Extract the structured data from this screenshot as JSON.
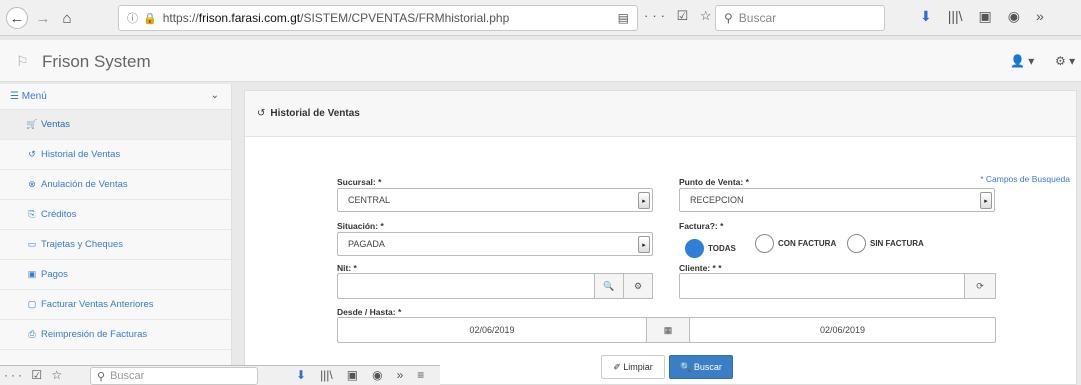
{
  "browser": {
    "url_host": "frison.farasi.com.gt",
    "url_prefix": "https://",
    "url_path": "/SISTEM/CPVENTAS/FRMhistorial.php",
    "search_placeholder": "Buscar",
    "back_glyph": "←",
    "forward_glyph": "→",
    "home_glyph": "⌂",
    "info_glyph": "ⓘ",
    "lock_glyph": "🔒",
    "reader_glyph": "▤",
    "page_actions": "··· ☑ ☆",
    "search_glyph": "⚲",
    "tool_icons": [
      "⬇",
      "|||\\",
      "▣",
      "◉",
      "»"
    ],
    "accent_color": "#2a6fd6"
  },
  "app": {
    "brand": "Frison System",
    "user_menu": "👤 ▾",
    "settings_menu": "⚙ ▾"
  },
  "sidebar": {
    "menu_label": "☰ Menú",
    "chevron": "⌄",
    "items": [
      {
        "icon": "🛒",
        "label": "Ventas",
        "icon_name": "cart-icon"
      },
      {
        "icon": "↺",
        "label": "Historial de Ventas",
        "icon_name": "history-icon"
      },
      {
        "icon": "⊗",
        "label": "Anulación de Ventas",
        "icon_name": "cancel-circle-icon"
      },
      {
        "icon": "⎘",
        "label": "Créditos",
        "icon_name": "credit-icon"
      },
      {
        "icon": "▭",
        "label": "Trajetas y Cheques",
        "icon_name": "card-icon"
      },
      {
        "icon": "▣",
        "label": "Pagos",
        "icon_name": "payment-icon"
      },
      {
        "icon": "▢",
        "label": "Facturar Ventas Anteriores",
        "icon_name": "document-icon"
      },
      {
        "icon": "⎙",
        "label": "Reimpresión de Facturas",
        "icon_name": "print-icon"
      }
    ]
  },
  "panel": {
    "title": "Historial de Ventas",
    "title_icon": "↺",
    "required_note": "* Campos de Busqueda",
    "sucursal_label": "Sucursal: *",
    "sucursal_value": "CENTRAL",
    "punto_label": "Punto de Venta: *",
    "punto_value": "RECEPCION",
    "situacion_label": "Situación: *",
    "situacion_value": "PAGADA",
    "factura_label": "Factura?: *",
    "factura_options": [
      "TODAS",
      "CON FACTURA",
      "SIN FACTURA"
    ],
    "factura_selected": "TODAS",
    "nit_label": "Nit: *",
    "nit_value": "",
    "cliente_label": "Cliente: * *",
    "cliente_value": "",
    "fechas_label": "Desde / Hasta: *",
    "desde": "02/06/2019",
    "hasta": "02/06/2019",
    "select_arrow": "▸",
    "search_glyph": "🔍",
    "settings_glyph": "⚙",
    "refresh_glyph": "⟳",
    "calendar_glyph": "▦",
    "clear_label": "✐ Limpiar",
    "search_label": "🔍 Buscar",
    "accent_color": "#3a7fc6"
  },
  "overlay": {
    "page_actions": "··· ☑ ☆",
    "search_placeholder": "Buscar",
    "tool_icons": [
      "⬇",
      "|||\\",
      "▣",
      "◉",
      "»",
      "≡"
    ]
  }
}
